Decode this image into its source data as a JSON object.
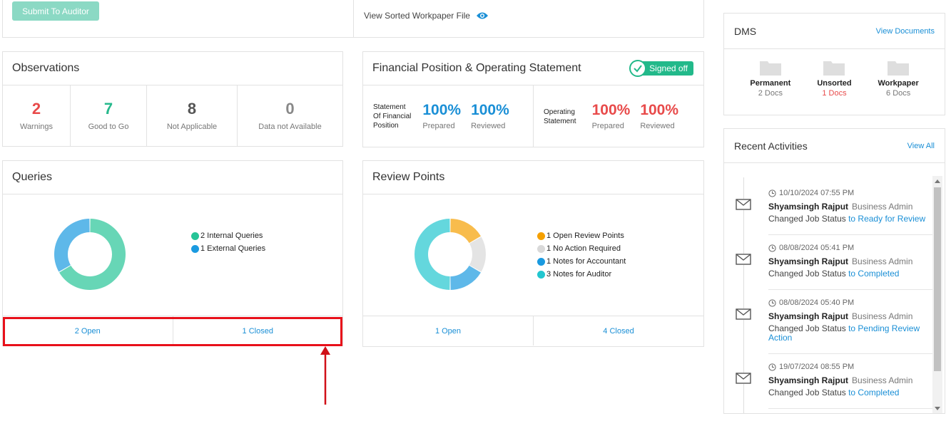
{
  "top": {
    "submit_label": "Submit To Auditor",
    "sorted_link": "View Sorted Workpaper File"
  },
  "observations": {
    "title": "Observations",
    "items": [
      {
        "value": "2",
        "label": "Warnings",
        "color": "#e84a4a"
      },
      {
        "value": "7",
        "label": "Good to Go",
        "color": "#26b98c"
      },
      {
        "value": "8",
        "label": "Not Applicable",
        "color": "#555555"
      },
      {
        "value": "0",
        "label": "Data not Available",
        "color": "#888888"
      }
    ]
  },
  "financial": {
    "title": "Financial Position & Operating Statement",
    "badge": "Signed off",
    "sfp": {
      "label_lines": [
        "Statement",
        "Of Financial",
        "Position"
      ],
      "prepared": "100%",
      "prepared_label": "Prepared",
      "reviewed": "100%",
      "reviewed_label": "Reviewed",
      "color": "#1a8fd6"
    },
    "os": {
      "label_lines": [
        "Operating",
        "Statement"
      ],
      "prepared": "100%",
      "prepared_label": "Prepared",
      "reviewed": "100%",
      "reviewed_label": "Reviewed",
      "color": "#e84a4a"
    }
  },
  "queries": {
    "title": "Queries",
    "legend": [
      {
        "label": "2 Internal Queries",
        "color": "#26c497",
        "value": 2
      },
      {
        "label": "1 External Queries",
        "color": "#1a9ae0",
        "value": 1
      }
    ],
    "open": "2 Open",
    "closed": "1 Closed"
  },
  "review": {
    "title": "Review Points",
    "legend": [
      {
        "label": "1 Open Review Points",
        "color": "#f5a000",
        "value": 1
      },
      {
        "label": "1 No Action Required",
        "color": "#d9d9d9",
        "value": 1
      },
      {
        "label": "1 Notes for Accountant",
        "color": "#1a9ae0",
        "value": 1
      },
      {
        "label": "3 Notes for Auditor",
        "color": "#22c6cf",
        "value": 3
      }
    ],
    "open": "1 Open",
    "closed": "4 Closed"
  },
  "dms": {
    "title": "DMS",
    "link": "View Documents",
    "items": [
      {
        "name": "Permanent",
        "count": "2 Docs"
      },
      {
        "name": "Unsorted",
        "count": "1 Docs"
      },
      {
        "name": "Workpaper",
        "count": "6 Docs"
      }
    ]
  },
  "recent": {
    "title": "Recent Activities",
    "link": "View All",
    "items": [
      {
        "time": "10/10/2024 07:55 PM",
        "user": "Shyamsingh Rajput",
        "role": "Business Admin",
        "action": "Changed Job Status ",
        "target": "to Ready for Review"
      },
      {
        "time": "08/08/2024 05:41 PM",
        "user": "Shyamsingh Rajput",
        "role": "Business Admin",
        "action": "Changed Job Status ",
        "target": "to Completed"
      },
      {
        "time": "08/08/2024 05:40 PM",
        "user": "Shyamsingh Rajput",
        "role": "Business Admin",
        "action": "Changed Job Status ",
        "target": "to Pending Review Action"
      },
      {
        "time": "19/07/2024 08:55 PM",
        "user": "Shyamsingh Rajput",
        "role": "Business Admin",
        "action": "Changed Job Status ",
        "target": "to Completed"
      }
    ]
  }
}
